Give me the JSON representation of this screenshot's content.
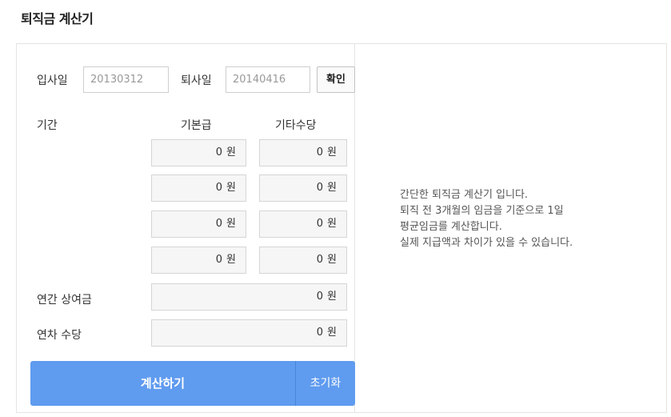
{
  "title": "퇴직금 계산기",
  "dates": {
    "join_label": "입사일",
    "join_value": "20130312",
    "leave_label": "퇴사일",
    "leave_value": "20140416",
    "confirm_label": "확인"
  },
  "table": {
    "period_header": "기간",
    "base_header": "기본급",
    "extra_header": "기타수당",
    "unit": "원",
    "rows": [
      {
        "base": "0",
        "extra": "0"
      },
      {
        "base": "0",
        "extra": "0"
      },
      {
        "base": "0",
        "extra": "0"
      },
      {
        "base": "0",
        "extra": "0"
      }
    ]
  },
  "bonus": {
    "label": "연간 상여금",
    "value": "0"
  },
  "leave_pay": {
    "label": "연차 수당",
    "value": "0"
  },
  "actions": {
    "calculate_label": "계산하기",
    "reset_label": "초기화"
  },
  "description": [
    "간단한 퇴직금 계산기 입니다.",
    "퇴직 전 3개월의 임금을 기준으로 1일",
    "평균임금를 계산합니다.",
    "실제 지급액과 차이가 있을 수 있습니다."
  ],
  "colors": {
    "primary_button": "#5f9bef"
  }
}
